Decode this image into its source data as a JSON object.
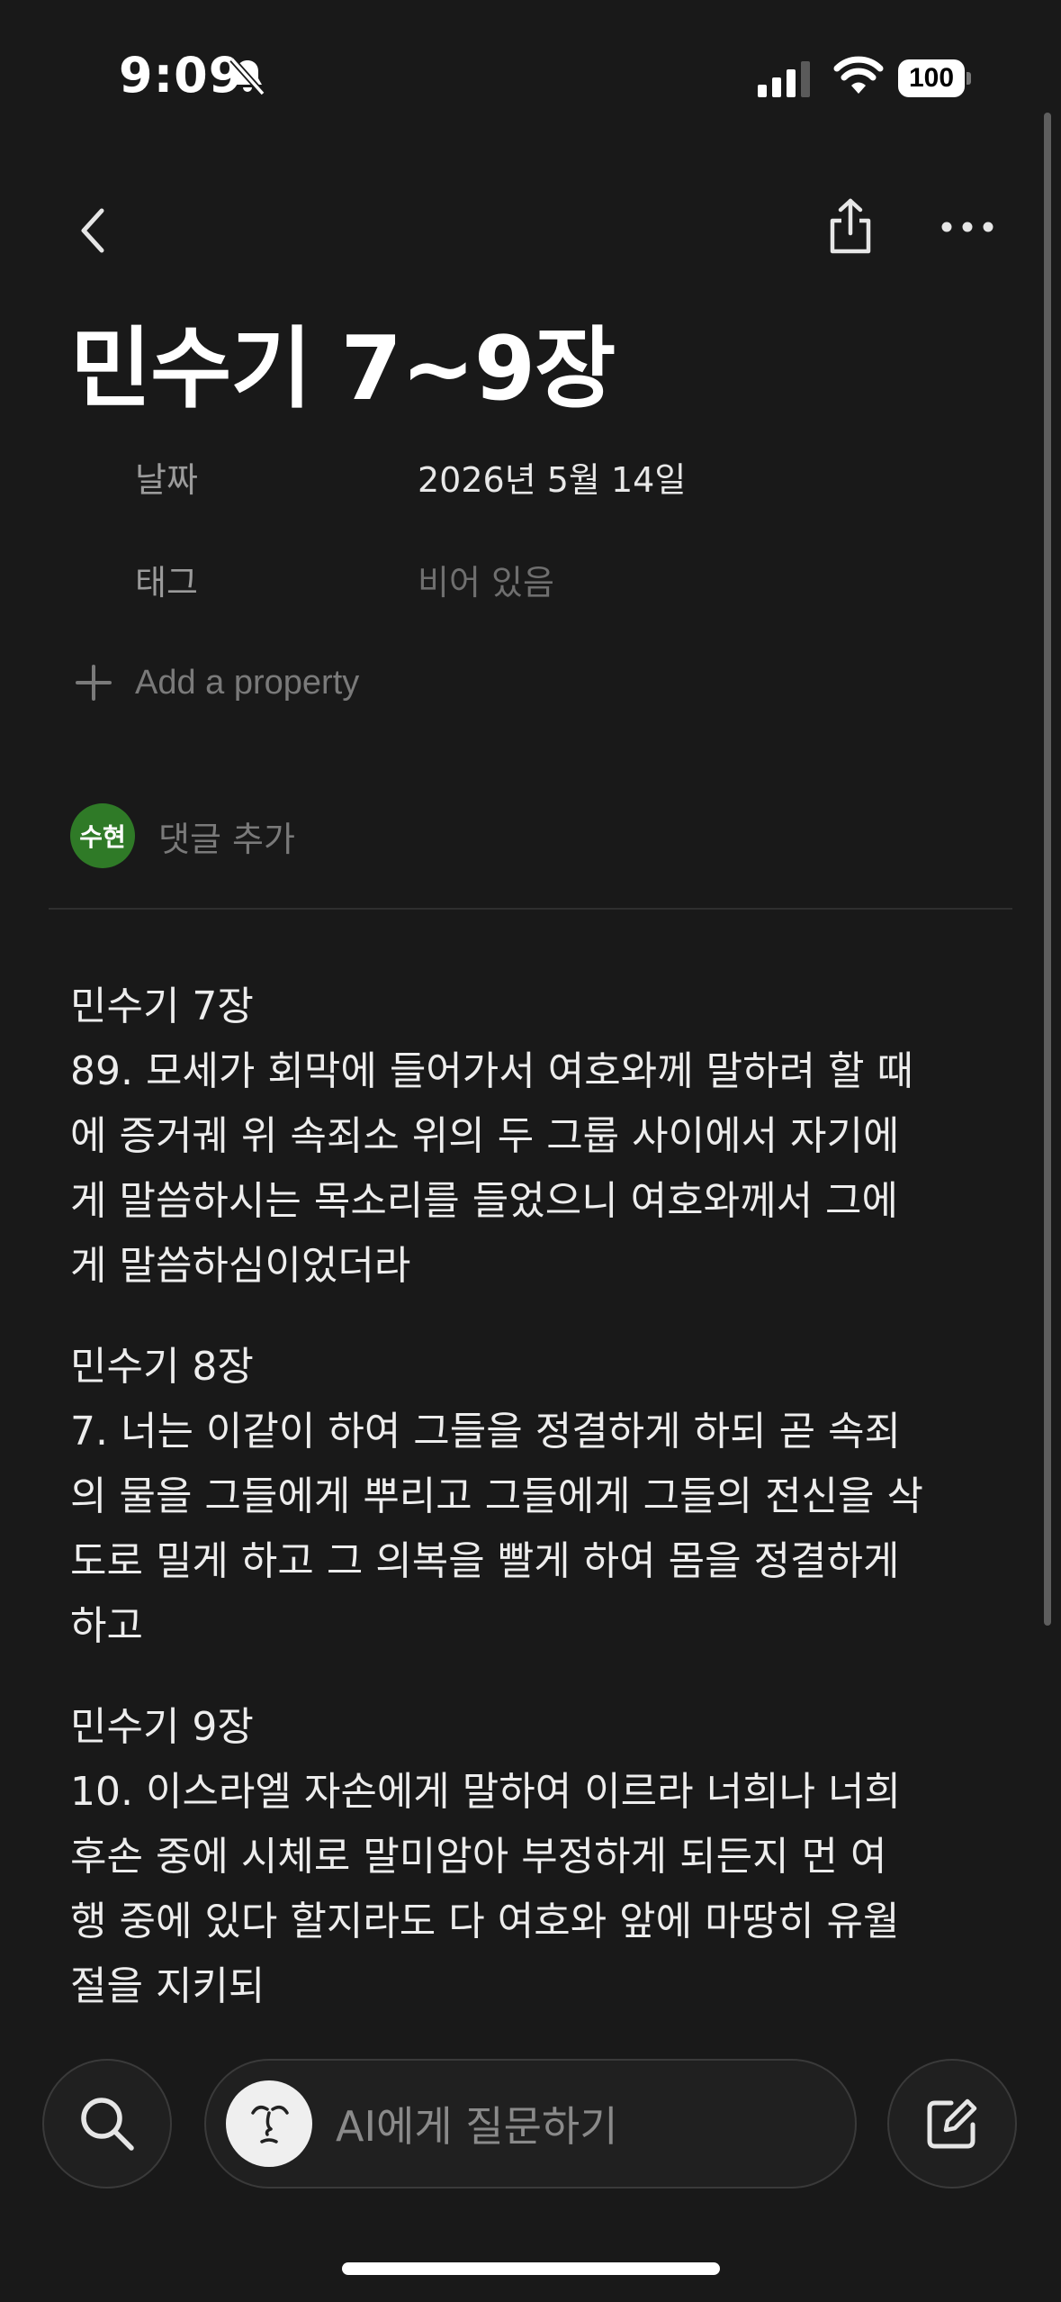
{
  "status_bar": {
    "time": "9:09",
    "battery": "100"
  },
  "nav": {
    "back_icon": "chevron-left-icon",
    "share_icon": "share-icon",
    "more_icon": "more-horizontal-icon"
  },
  "page": {
    "title": "민수기 7~9장"
  },
  "properties": [
    {
      "label": "날짜",
      "value": "2026년 5월 14일",
      "empty": false
    },
    {
      "label": "태그",
      "value": "비어 있음",
      "empty": true
    }
  ],
  "add_property_label": "Add a property",
  "comment": {
    "avatar_text": "수현",
    "avatar_color": "#2f7a27",
    "placeholder": "댓글 추가"
  },
  "content": {
    "blocks": [
      {
        "heading": "민수기 7장",
        "lines": [
          "89. 모세가 회막에 들어가서 여호와께 말하려 할 때",
          "에 증거궤 위 속죄소 위의 두 그룹 사이에서 자기에",
          "게 말씀하시는 목소리를 들었으니 여호와께서 그에",
          "게 말씀하심이었더라"
        ]
      },
      {
        "heading": "민수기 8장",
        "lines": [
          "7. 너는 이같이 하여 그들을 정결하게 하되 곧 속죄",
          "의 물을 그들에게 뿌리고 그들에게 그들의 전신을 삭",
          "도로 밀게 하고 그 의복을 빨게 하여 몸을 정결하게",
          "하고"
        ]
      },
      {
        "heading": "민수기 9장",
        "lines": [
          "10. 이스라엘 자손에게 말하여 이르라 너희나 너희",
          "후손 중에 시체로 말미암아 부정하게 되든지 먼 여",
          "행 중에 있다 할지라도 다 여호와 앞에 마땅히 유월",
          "절을 지키되"
        ]
      }
    ]
  },
  "toolbar": {
    "search_icon": "search-icon",
    "ai_placeholder": "AI에게 질문하기",
    "compose_icon": "compose-icon"
  }
}
